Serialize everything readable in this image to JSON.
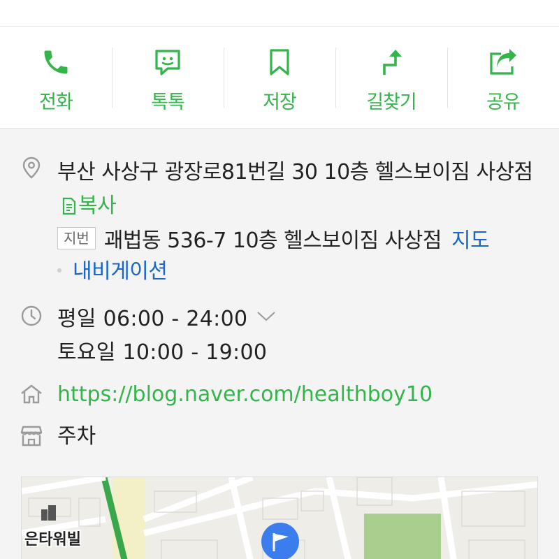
{
  "actions": [
    {
      "label": "전화",
      "icon": "phone-icon"
    },
    {
      "label": "톡톡",
      "icon": "chat-icon"
    },
    {
      "label": "저장",
      "icon": "bookmark-icon"
    },
    {
      "label": "길찾기",
      "icon": "directions-icon"
    },
    {
      "label": "공유",
      "icon": "share-icon"
    }
  ],
  "address": {
    "road": "부산 사상구 광장로81번길 30 10층 헬스보이짐 사상점",
    "copy_label": "복사",
    "jibun_tag": "지번",
    "jibun": "괘법동 536-7 10층 헬스보이짐 사상점",
    "map_link": "지도",
    "navigation_link": "내비게이션"
  },
  "hours": {
    "weekday": "평일 06:00 - 24:00",
    "saturday": "토요일 10:00 - 19:00"
  },
  "homepage": "https://blog.naver.com/healthboy10",
  "parking": "주차",
  "map": {
    "building_label": "은타워빌"
  },
  "colors": {
    "accent_green": "#33b54a",
    "link_blue": "#1a67c8",
    "icon_gray": "#9a9a9a"
  }
}
